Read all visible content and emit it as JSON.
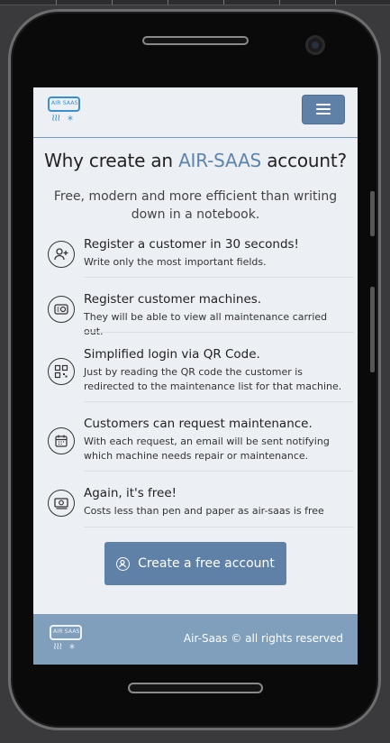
{
  "app": {
    "logo_text": "AIR SAAS",
    "headline_prefix": "Why create an",
    "headline_brand": "AIR-SAAS",
    "headline_suffix": "account?",
    "subheading": "Free, modern and more efficient than writing down in a notebook."
  },
  "features": [
    {
      "title": "Register a customer in 30 seconds!",
      "description": "Write only the most important fields.",
      "icon": "add-user-icon"
    },
    {
      "title": "Register customer machines.",
      "description": "They will be able to view all maintenance carried out.",
      "icon": "air-conditioner-icon"
    },
    {
      "title": "Simplified login via QR Code.",
      "description": "Just by reading the QR code the customer is redirected to the maintenance list for that machine.",
      "icon": "qr-code-icon"
    },
    {
      "title": "Customers can request maintenance.",
      "description": "With each request, an email will be sent notifying which machine needs repair or maintenance.",
      "icon": "calendar-icon"
    },
    {
      "title": "Again, it's free!",
      "description": "Costs less than pen and paper as air-saas is free",
      "icon": "money-icon"
    }
  ],
  "cta": {
    "label": "Create a free account",
    "icon": "user-circle-icon"
  },
  "footer": {
    "copyright": "Air-Saas © all rights reserved"
  },
  "colors": {
    "brand": "#5f84ab",
    "button": "#5f81a8",
    "footer": "#7f9fbd",
    "background": "#eceff4"
  }
}
